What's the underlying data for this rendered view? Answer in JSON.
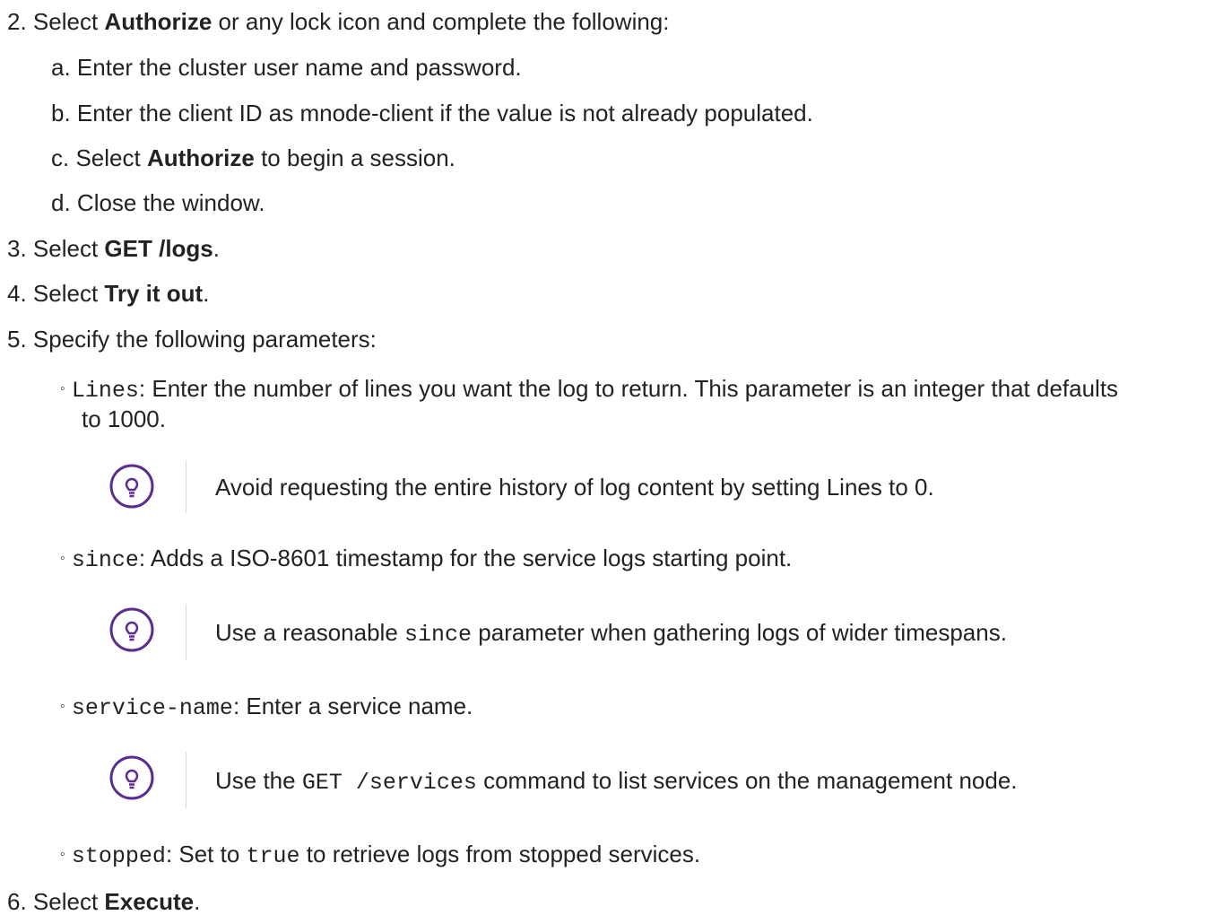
{
  "steps": {
    "s2": {
      "num": "2.",
      "pre": "Select ",
      "bold": "Authorize",
      "post": " or any lock icon and complete the following:"
    },
    "a": {
      "num": "a.",
      "text": "Enter the cluster user name and password."
    },
    "b": {
      "num": "b.",
      "text": "Enter the client ID as mnode-client if the value is not already populated."
    },
    "c": {
      "num": "c.",
      "pre": "Select ",
      "bold": "Authorize",
      "post": " to begin a session."
    },
    "d": {
      "num": "d.",
      "text": "Close the window."
    },
    "s3": {
      "num": "3.",
      "pre": "Select ",
      "bold": "GET /logs",
      "post": "."
    },
    "s4": {
      "num": "4.",
      "pre": "Select ",
      "bold": "Try it out",
      "post": "."
    },
    "s5": {
      "num": "5.",
      "text": "Specify the following parameters:"
    },
    "s6": {
      "num": "6.",
      "pre": "Select ",
      "bold": "Execute",
      "post": "."
    }
  },
  "params": {
    "bullet": "◦",
    "lines": {
      "code": "Lines",
      "text": ": Enter the number of lines you want the log to return. This parameter is an integer that defaults",
      "text2": "to 1000."
    },
    "since": {
      "code": "since",
      "text": ": Adds a ISO-8601 timestamp for the service logs starting point."
    },
    "service": {
      "code": "service-name",
      "text": ": Enter a service name."
    },
    "stopped": {
      "code": "stopped",
      "pre": ": Set to ",
      "code2": "true",
      "post": " to retrieve logs from stopped services."
    }
  },
  "tips": {
    "tip1": {
      "text": "Avoid requesting the entire history of log content by setting Lines to 0."
    },
    "tip2": {
      "pre": "Use a reasonable ",
      "code": "since",
      "post": " parameter when gathering logs of wider timespans."
    },
    "tip3": {
      "pre": "Use the ",
      "code": "GET /services",
      "post": " command to list services on the management node."
    }
  },
  "colors": {
    "tip_icon": "#5b2d91",
    "rule": "#d9d9d9",
    "text": "#222222"
  },
  "icons": {
    "tip": "lightbulb-icon"
  }
}
